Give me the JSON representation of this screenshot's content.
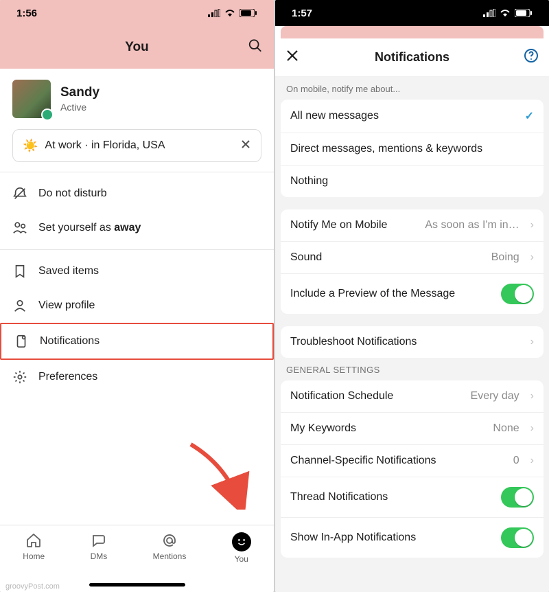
{
  "left": {
    "time": "1:56",
    "header_title": "You",
    "profile": {
      "name": "Sandy",
      "presence": "Active"
    },
    "status_text": "At work · in Florida, USA",
    "menu": {
      "dnd": "Do not disturb",
      "away_prefix": "Set yourself as ",
      "away_bold": "away",
      "saved": "Saved items",
      "view_profile": "View profile",
      "notifications": "Notifications",
      "preferences": "Preferences"
    },
    "tabs": {
      "home": "Home",
      "dms": "DMs",
      "mentions": "Mentions",
      "you": "You"
    },
    "watermark": "groovyPost.com"
  },
  "right": {
    "time": "1:57",
    "sheet_title": "Notifications",
    "caption_top": "On mobile, notify me about...",
    "radio": {
      "all": "All new messages",
      "dm": "Direct messages, mentions & keywords",
      "nothing": "Nothing"
    },
    "notify_mobile_label": "Notify Me on Mobile",
    "notify_mobile_value": "As soon as I'm in…",
    "sound_label": "Sound",
    "sound_value": "Boing",
    "preview_label": "Include a Preview of the Message",
    "troubleshoot": "Troubleshoot Notifications",
    "general_caption": "General Settings",
    "schedule_label": "Notification Schedule",
    "schedule_value": "Every day",
    "keywords_label": "My Keywords",
    "keywords_value": "None",
    "channel_label": "Channel-Specific Notifications",
    "channel_value": "0",
    "thread_label": "Thread Notifications",
    "inapp_label": "Show In-App Notifications"
  }
}
